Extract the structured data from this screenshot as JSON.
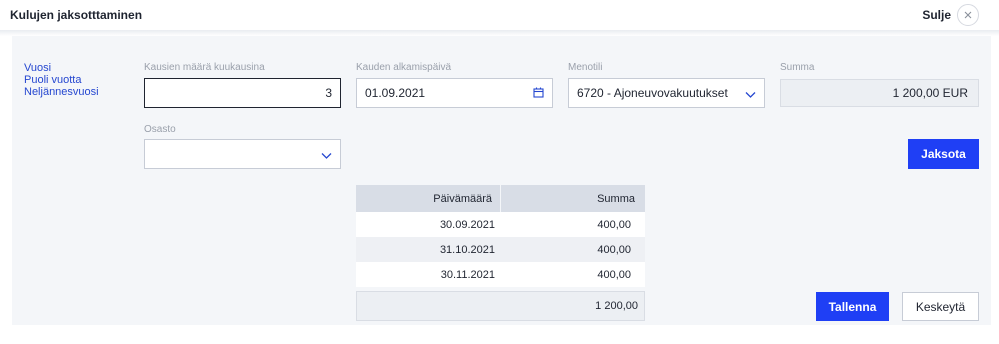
{
  "header": {
    "title": "Kulujen jaksotttaminen",
    "close_label": "Sulje"
  },
  "period_options": [
    "Vuosi",
    "Puoli vuotta",
    "Neljännesvuosi"
  ],
  "fields": {
    "periods_label": "Kausien määrä kuukausina",
    "periods_value": "3",
    "start_date_label": "Kauden alkamispäivä",
    "start_date_value": "01.09.2021",
    "expense_account_label": "Menotili",
    "expense_account_value": "6720 - Ajoneuvovakuutukset",
    "amount_label": "Summa",
    "amount_value": "1 200,00 EUR",
    "department_label": "Osasto",
    "department_value": ""
  },
  "buttons": {
    "allocate": "Jaksota",
    "save": "Tallenna",
    "cancel": "Keskeytä"
  },
  "table": {
    "headers": [
      "Päivämäärä",
      "Summa"
    ],
    "rows": [
      [
        "30.09.2021",
        "400,00"
      ],
      [
        "31.10.2021",
        "400,00"
      ],
      [
        "30.11.2021",
        "400,00"
      ]
    ],
    "total": "1 200,00"
  },
  "colors": {
    "accent": "#1f3ff5",
    "link": "#2547d0"
  }
}
